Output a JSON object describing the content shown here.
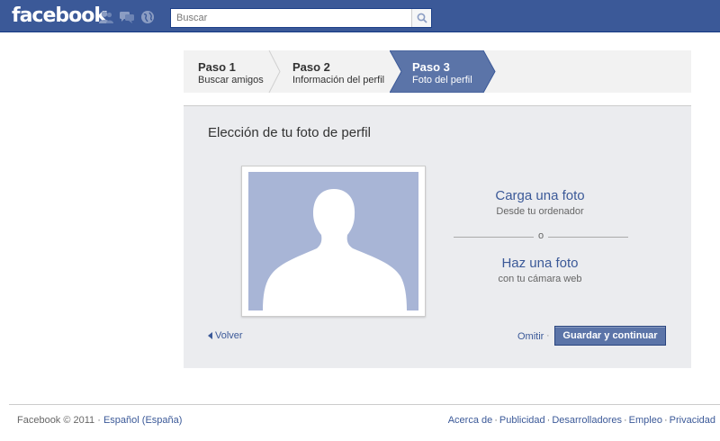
{
  "header": {
    "logo": "facebook",
    "search": {
      "placeholder": "Buscar",
      "value": ""
    },
    "jewels": [
      "friend-requests-icon",
      "messages-icon",
      "notifications-globe-icon"
    ]
  },
  "steps": [
    {
      "title": "Paso 1",
      "subtitle": "Buscar amigos",
      "active": false
    },
    {
      "title": "Paso 2",
      "subtitle": "Información del perfil",
      "active": false
    },
    {
      "title": "Paso 3",
      "subtitle": "Foto del perfil",
      "active": true
    }
  ],
  "panel": {
    "title": "Elección de tu foto de perfil",
    "upload": {
      "title": "Carga una foto",
      "subtitle": "Desde tu ordenador"
    },
    "or_word": "o",
    "webcam": {
      "title": "Haz una foto",
      "subtitle": "con tu cámara web"
    },
    "back_label": "Volver",
    "skip_label": "Omitir",
    "save_label": "Guardar y continuar"
  },
  "footer": {
    "copyright": "Facebook © 2011 ·",
    "language": "Español (España)",
    "links": [
      "Acerca de",
      "Publicidad",
      "Desarrolladores",
      "Empleo",
      "Privacidad"
    ]
  },
  "colors": {
    "brand": "#3b5998",
    "active_step": "#5b74a8",
    "silhouette_bg": "#a8b5d6"
  }
}
